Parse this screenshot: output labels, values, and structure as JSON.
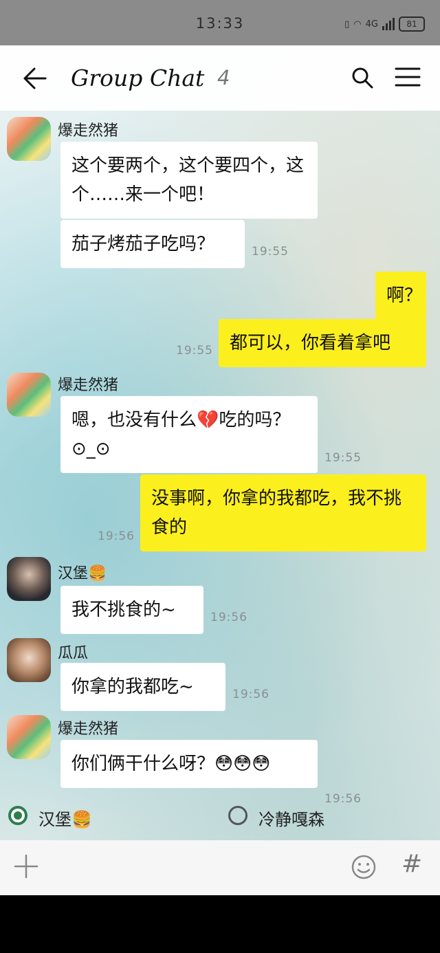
{
  "status": {
    "time": "13:33",
    "network": "4G",
    "battery": "81"
  },
  "header": {
    "title": "Group Chat",
    "count": "4"
  },
  "messages": [
    {
      "sender": "爆走然猪",
      "text": "这个要两个，这个要四个，这个……来一个吧！"
    },
    {
      "text": "茄子烤茄子吃吗？",
      "time": "19:55"
    },
    {
      "text": "啊？"
    },
    {
      "text": "都可以，你看着拿吧",
      "time": "19:55"
    },
    {
      "sender": "爆走然猪",
      "text": "嗯，也没有什么💔吃的吗？⊙_⊙",
      "time": "19:55"
    },
    {
      "text": "没事啊，你拿的我都吃，我不挑食的",
      "time": "19:56"
    },
    {
      "sender": "汉堡🍔",
      "text": "我不挑食的~",
      "time": "19:56"
    },
    {
      "sender": "瓜瓜",
      "text": "你拿的我都吃~",
      "time": "19:56"
    },
    {
      "sender": "爆走然猪",
      "text": "你们俩干什么呀？😳😳😳",
      "time": "19:56"
    }
  ],
  "mention_options": [
    {
      "label": "汉堡🍔",
      "selected": true
    },
    {
      "label": "冷静嘎森",
      "selected": false
    }
  ],
  "input": {
    "hash": "#"
  }
}
